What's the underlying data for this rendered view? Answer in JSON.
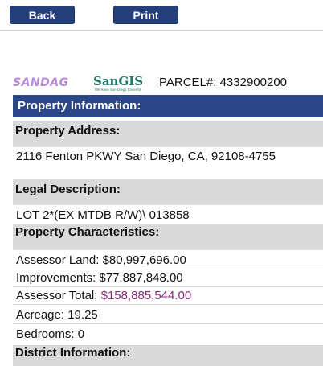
{
  "toolbar": {
    "back_label": "Back",
    "print_label": "Print"
  },
  "logos": {
    "sandag_text": "SANDAG",
    "sangis_text": "SanGIS",
    "sangis_tagline": "We Have San Diego Covered"
  },
  "parcel": {
    "label": "PARCEL#:",
    "number": "4332900200",
    "display": "PARCEL#: 4332900200"
  },
  "property_information": {
    "header": "Property Information:",
    "address_label": "Property Address:",
    "address_value": "2116 Fenton PKWY San Diego, CA, 92108-4755",
    "legal_label": "Legal Description:",
    "legal_value": "LOT 2*(EX MTDB R/W)\\ 013858",
    "characteristics_label": "Property Characteristics:",
    "assessor_land_label": "Assessor Land:",
    "assessor_land_value": "$80,997,696.00",
    "improvements_label": "Improvements:",
    "improvements_value": "$77,887,848.00",
    "assessor_total_label": "Assessor Total:",
    "assessor_total_value": "$158,885,544.00",
    "acreage_label": "Acreage:",
    "acreage_value": "19.25",
    "bedrooms_label": "Bedrooms:",
    "bedrooms_value": "0",
    "district_label": "District Information:"
  },
  "colors": {
    "header_bg": "#2b4787",
    "button_bg": "#253f7a",
    "label_bg": "#d9d9d9",
    "accent_value": "#8e2a7a",
    "sandag_logo": "#b58ad6",
    "sangis_logo": "#1f7a6a"
  }
}
